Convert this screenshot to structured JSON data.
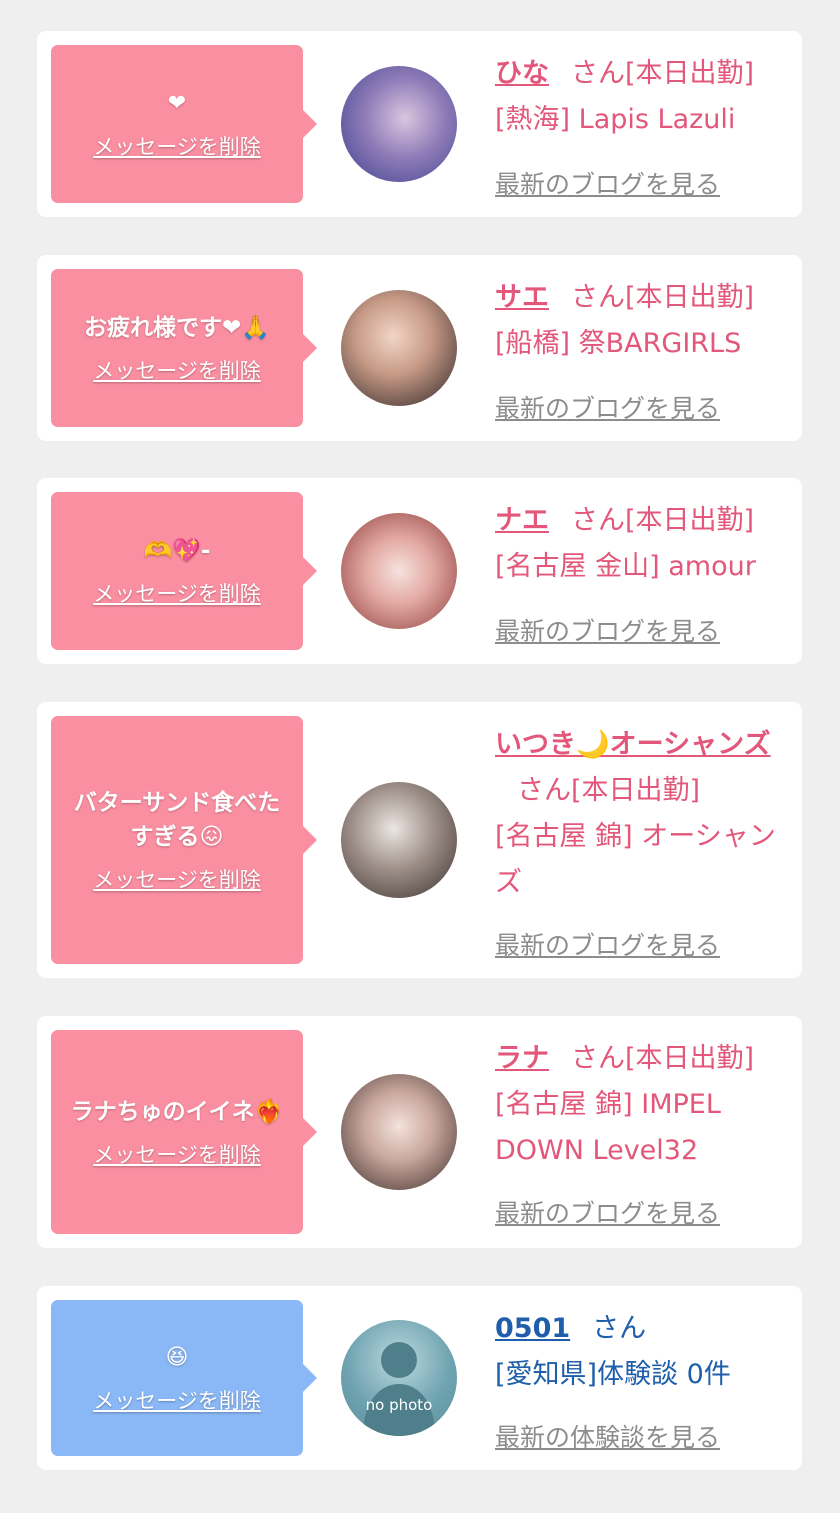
{
  "delete_label": "メッセージを削除",
  "cards": [
    {
      "message": "❤",
      "name": "ひな",
      "honorific": "さん[本日出勤]",
      "shop": "[熱海] Lapis Lazuli",
      "link": "最新のブログを見る"
    },
    {
      "message": "お疲れ様です❤🙏",
      "name": "サエ",
      "honorific": "さん[本日出勤]",
      "shop": "[船橋] 祭BARGIRLS",
      "link": "最新のブログを見る"
    },
    {
      "message": "🫶💖-",
      "name": "ナエ",
      "honorific": "さん[本日出勤]",
      "shop": "[名古屋 金山] amour",
      "link": "最新のブログを見る"
    },
    {
      "message": "バターサンド食べたすぎる😖",
      "name": "いつき🌙オーシャンズ",
      "honorific": "さん[本日出勤]",
      "shop": "[名古屋 錦] オーシャンズ",
      "link": "最新のブログを見る"
    },
    {
      "message": "ラナちゅのイイネ❤‍🔥",
      "name": "ラナ",
      "honorific": "さん[本日出勤]",
      "shop": "[名古屋 錦] IMPEL DOWN Level32",
      "link": "最新のブログを見る"
    },
    {
      "message": "😆",
      "name": "0501",
      "honorific": "さん",
      "shop": "[愛知県]体験談 0件",
      "link": "最新の体験談を見る",
      "avatar_text": "no photo"
    }
  ],
  "colors": {
    "pink_bubble": "#fb8fa2",
    "blue_bubble": "#8ab8f7",
    "pink_text": "#e2577a",
    "blue_text": "#1e5eaa",
    "link_gray": "#8c8c8c"
  }
}
